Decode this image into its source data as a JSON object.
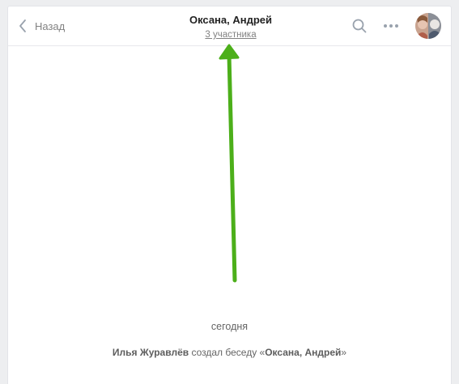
{
  "header": {
    "back_label": "Назад",
    "title": "Оксана, Андрей",
    "members_link": "3 участника"
  },
  "icons": {
    "back": "chevron-left-icon",
    "search": "search-icon",
    "more": "more-dots-icon",
    "avatar": "chat-avatar"
  },
  "annotation": {
    "color": "#4caf1a",
    "points_to": "members_link"
  },
  "history": {
    "date_label": "сегодня",
    "system_message": {
      "actor": "Илья Журавлёв",
      "action": " создал беседу «",
      "chat_name": "Оксана, Андрей",
      "closing": "»"
    }
  },
  "colors": {
    "background": "#edeef0",
    "panel": "#ffffff",
    "muted_text": "#828282",
    "title_text": "#222222"
  }
}
